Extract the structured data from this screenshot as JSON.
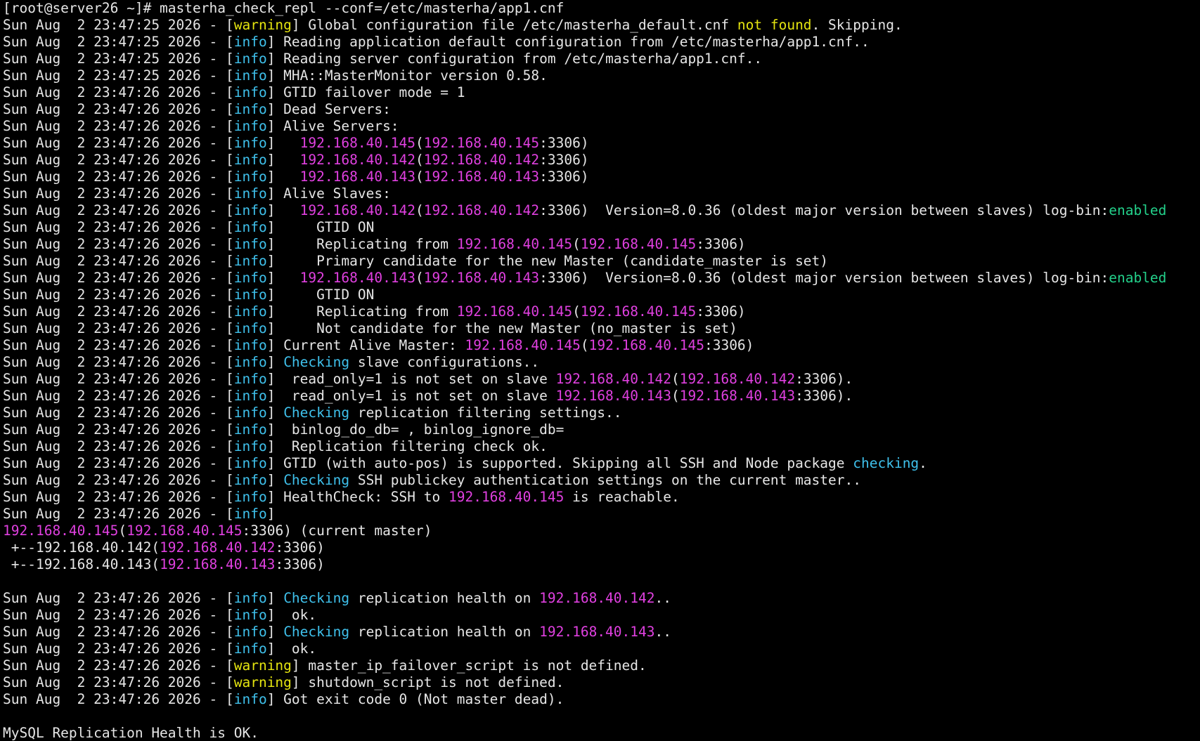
{
  "colors": {
    "background": "#000000",
    "text": "#e6e6e6",
    "warning": "#e5e510",
    "info": "#3fc1ec",
    "ip": "#e040e0",
    "enabled": "#23d18b"
  },
  "lines": [
    [
      {
        "t": "[root@server26 ~]# masterha_check_repl --conf=/etc/masterha/app1.cnf"
      }
    ],
    [
      {
        "t": "Sun Aug  2 23:47:25 2026 - ["
      },
      {
        "t": "warning",
        "c": "warn"
      },
      {
        "t": "] Global configuration file /etc/masterha_default.cnf "
      },
      {
        "t": "not found",
        "c": "warn"
      },
      {
        "t": ". Skipping."
      }
    ],
    [
      {
        "t": "Sun Aug  2 23:47:25 2026 - ["
      },
      {
        "t": "info",
        "c": "info"
      },
      {
        "t": "] Reading application default configuration from /etc/masterha/app1.cnf.."
      }
    ],
    [
      {
        "t": "Sun Aug  2 23:47:25 2026 - ["
      },
      {
        "t": "info",
        "c": "info"
      },
      {
        "t": "] Reading server configuration from /etc/masterha/app1.cnf.."
      }
    ],
    [
      {
        "t": "Sun Aug  2 23:47:25 2026 - ["
      },
      {
        "t": "info",
        "c": "info"
      },
      {
        "t": "] MHA::MasterMonitor version 0.58."
      }
    ],
    [
      {
        "t": "Sun Aug  2 23:47:26 2026 - ["
      },
      {
        "t": "info",
        "c": "info"
      },
      {
        "t": "] GTID failover mode = 1"
      }
    ],
    [
      {
        "t": "Sun Aug  2 23:47:26 2026 - ["
      },
      {
        "t": "info",
        "c": "info"
      },
      {
        "t": "] Dead Servers:"
      }
    ],
    [
      {
        "t": "Sun Aug  2 23:47:26 2026 - ["
      },
      {
        "t": "info",
        "c": "info"
      },
      {
        "t": "] Alive Servers:"
      }
    ],
    [
      {
        "t": "Sun Aug  2 23:47:26 2026 - ["
      },
      {
        "t": "info",
        "c": "info"
      },
      {
        "t": "]   "
      },
      {
        "t": "192.168.40.145",
        "c": "ip"
      },
      {
        "t": "("
      },
      {
        "t": "192.168.40.145",
        "c": "ip"
      },
      {
        "t": ":3306)"
      }
    ],
    [
      {
        "t": "Sun Aug  2 23:47:26 2026 - ["
      },
      {
        "t": "info",
        "c": "info"
      },
      {
        "t": "]   "
      },
      {
        "t": "192.168.40.142",
        "c": "ip"
      },
      {
        "t": "("
      },
      {
        "t": "192.168.40.142",
        "c": "ip"
      },
      {
        "t": ":3306)"
      }
    ],
    [
      {
        "t": "Sun Aug  2 23:47:26 2026 - ["
      },
      {
        "t": "info",
        "c": "info"
      },
      {
        "t": "]   "
      },
      {
        "t": "192.168.40.143",
        "c": "ip"
      },
      {
        "t": "("
      },
      {
        "t": "192.168.40.143",
        "c": "ip"
      },
      {
        "t": ":3306)"
      }
    ],
    [
      {
        "t": "Sun Aug  2 23:47:26 2026 - ["
      },
      {
        "t": "info",
        "c": "info"
      },
      {
        "t": "] Alive Slaves:"
      }
    ],
    [
      {
        "t": "Sun Aug  2 23:47:26 2026 - ["
      },
      {
        "t": "info",
        "c": "info"
      },
      {
        "t": "]   "
      },
      {
        "t": "192.168.40.142",
        "c": "ip"
      },
      {
        "t": "("
      },
      {
        "t": "192.168.40.142",
        "c": "ip"
      },
      {
        "t": ":3306)  Version=8.0.36 (oldest major version between slaves) log-bin:"
      },
      {
        "t": "enabled",
        "c": "ok"
      }
    ],
    [
      {
        "t": "Sun Aug  2 23:47:26 2026 - ["
      },
      {
        "t": "info",
        "c": "info"
      },
      {
        "t": "]     GTID ON"
      }
    ],
    [
      {
        "t": "Sun Aug  2 23:47:26 2026 - ["
      },
      {
        "t": "info",
        "c": "info"
      },
      {
        "t": "]     Replicating from "
      },
      {
        "t": "192.168.40.145",
        "c": "ip"
      },
      {
        "t": "("
      },
      {
        "t": "192.168.40.145",
        "c": "ip"
      },
      {
        "t": ":3306)"
      }
    ],
    [
      {
        "t": "Sun Aug  2 23:47:26 2026 - ["
      },
      {
        "t": "info",
        "c": "info"
      },
      {
        "t": "]     Primary candidate for the new Master (candidate_master is set)"
      }
    ],
    [
      {
        "t": "Sun Aug  2 23:47:26 2026 - ["
      },
      {
        "t": "info",
        "c": "info"
      },
      {
        "t": "]   "
      },
      {
        "t": "192.168.40.143",
        "c": "ip"
      },
      {
        "t": "("
      },
      {
        "t": "192.168.40.143",
        "c": "ip"
      },
      {
        "t": ":3306)  Version=8.0.36 (oldest major version between slaves) log-bin:"
      },
      {
        "t": "enabled",
        "c": "ok"
      }
    ],
    [
      {
        "t": "Sun Aug  2 23:47:26 2026 - ["
      },
      {
        "t": "info",
        "c": "info"
      },
      {
        "t": "]     GTID ON"
      }
    ],
    [
      {
        "t": "Sun Aug  2 23:47:26 2026 - ["
      },
      {
        "t": "info",
        "c": "info"
      },
      {
        "t": "]     Replicating from "
      },
      {
        "t": "192.168.40.145",
        "c": "ip"
      },
      {
        "t": "("
      },
      {
        "t": "192.168.40.145",
        "c": "ip"
      },
      {
        "t": ":3306)"
      }
    ],
    [
      {
        "t": "Sun Aug  2 23:47:26 2026 - ["
      },
      {
        "t": "info",
        "c": "info"
      },
      {
        "t": "]     Not candidate for the new Master (no_master is set)"
      }
    ],
    [
      {
        "t": "Sun Aug  2 23:47:26 2026 - ["
      },
      {
        "t": "info",
        "c": "info"
      },
      {
        "t": "] Current Alive Master: "
      },
      {
        "t": "192.168.40.145",
        "c": "ip"
      },
      {
        "t": "("
      },
      {
        "t": "192.168.40.145",
        "c": "ip"
      },
      {
        "t": ":3306)"
      }
    ],
    [
      {
        "t": "Sun Aug  2 23:47:26 2026 - ["
      },
      {
        "t": "info",
        "c": "info"
      },
      {
        "t": "] "
      },
      {
        "t": "Checking",
        "c": "info"
      },
      {
        "t": " slave configurations.."
      }
    ],
    [
      {
        "t": "Sun Aug  2 23:47:26 2026 - ["
      },
      {
        "t": "info",
        "c": "info"
      },
      {
        "t": "]  read_only=1 is not set on slave "
      },
      {
        "t": "192.168.40.142",
        "c": "ip"
      },
      {
        "t": "("
      },
      {
        "t": "192.168.40.142",
        "c": "ip"
      },
      {
        "t": ":3306)."
      }
    ],
    [
      {
        "t": "Sun Aug  2 23:47:26 2026 - ["
      },
      {
        "t": "info",
        "c": "info"
      },
      {
        "t": "]  read_only=1 is not set on slave "
      },
      {
        "t": "192.168.40.143",
        "c": "ip"
      },
      {
        "t": "("
      },
      {
        "t": "192.168.40.143",
        "c": "ip"
      },
      {
        "t": ":3306)."
      }
    ],
    [
      {
        "t": "Sun Aug  2 23:47:26 2026 - ["
      },
      {
        "t": "info",
        "c": "info"
      },
      {
        "t": "] "
      },
      {
        "t": "Checking",
        "c": "info"
      },
      {
        "t": " replication filtering settings.."
      }
    ],
    [
      {
        "t": "Sun Aug  2 23:47:26 2026 - ["
      },
      {
        "t": "info",
        "c": "info"
      },
      {
        "t": "]  binlog_do_db= , binlog_ignore_db="
      }
    ],
    [
      {
        "t": "Sun Aug  2 23:47:26 2026 - ["
      },
      {
        "t": "info",
        "c": "info"
      },
      {
        "t": "]  Replication filtering check ok."
      }
    ],
    [
      {
        "t": "Sun Aug  2 23:47:26 2026 - ["
      },
      {
        "t": "info",
        "c": "info"
      },
      {
        "t": "] GTID (with auto-pos) is supported. Skipping all SSH and Node package "
      },
      {
        "t": "checking",
        "c": "info"
      },
      {
        "t": "."
      }
    ],
    [
      {
        "t": "Sun Aug  2 23:47:26 2026 - ["
      },
      {
        "t": "info",
        "c": "info"
      },
      {
        "t": "] "
      },
      {
        "t": "Checking",
        "c": "info"
      },
      {
        "t": " SSH publickey authentication settings on the current master.."
      }
    ],
    [
      {
        "t": "Sun Aug  2 23:47:26 2026 - ["
      },
      {
        "t": "info",
        "c": "info"
      },
      {
        "t": "] HealthCheck: SSH to "
      },
      {
        "t": "192.168.40.145",
        "c": "ip"
      },
      {
        "t": " is reachable."
      }
    ],
    [
      {
        "t": "Sun Aug  2 23:47:26 2026 - ["
      },
      {
        "t": "info",
        "c": "info"
      },
      {
        "t": "]"
      }
    ],
    [
      {
        "t": "192.168.40.145",
        "c": "ip"
      },
      {
        "t": "("
      },
      {
        "t": "192.168.40.145",
        "c": "ip"
      },
      {
        "t": ":3306) (current master)"
      }
    ],
    [
      {
        "t": " +--192.168.40.142("
      },
      {
        "t": "192.168.40.142",
        "c": "ip"
      },
      {
        "t": ":3306)"
      }
    ],
    [
      {
        "t": " +--192.168.40.143("
      },
      {
        "t": "192.168.40.143",
        "c": "ip"
      },
      {
        "t": ":3306)"
      }
    ],
    [],
    [
      {
        "t": "Sun Aug  2 23:47:26 2026 - ["
      },
      {
        "t": "info",
        "c": "info"
      },
      {
        "t": "] "
      },
      {
        "t": "Checking",
        "c": "info"
      },
      {
        "t": " replication health on "
      },
      {
        "t": "192.168.40.142",
        "c": "ip"
      },
      {
        "t": ".."
      }
    ],
    [
      {
        "t": "Sun Aug  2 23:47:26 2026 - ["
      },
      {
        "t": "info",
        "c": "info"
      },
      {
        "t": "]  ok."
      }
    ],
    [
      {
        "t": "Sun Aug  2 23:47:26 2026 - ["
      },
      {
        "t": "info",
        "c": "info"
      },
      {
        "t": "] "
      },
      {
        "t": "Checking",
        "c": "info"
      },
      {
        "t": " replication health on "
      },
      {
        "t": "192.168.40.143",
        "c": "ip"
      },
      {
        "t": ".."
      }
    ],
    [
      {
        "t": "Sun Aug  2 23:47:26 2026 - ["
      },
      {
        "t": "info",
        "c": "info"
      },
      {
        "t": "]  ok."
      }
    ],
    [
      {
        "t": "Sun Aug  2 23:47:26 2026 - ["
      },
      {
        "t": "warning",
        "c": "warn"
      },
      {
        "t": "] master_ip_failover_script is not defined."
      }
    ],
    [
      {
        "t": "Sun Aug  2 23:47:26 2026 - ["
      },
      {
        "t": "warning",
        "c": "warn"
      },
      {
        "t": "] shutdown_script is not defined."
      }
    ],
    [
      {
        "t": "Sun Aug  2 23:47:26 2026 - ["
      },
      {
        "t": "info",
        "c": "info"
      },
      {
        "t": "] Got exit code 0 (Not master dead)."
      }
    ],
    [],
    [
      {
        "t": "MySQL Replication Health is OK."
      }
    ]
  ]
}
